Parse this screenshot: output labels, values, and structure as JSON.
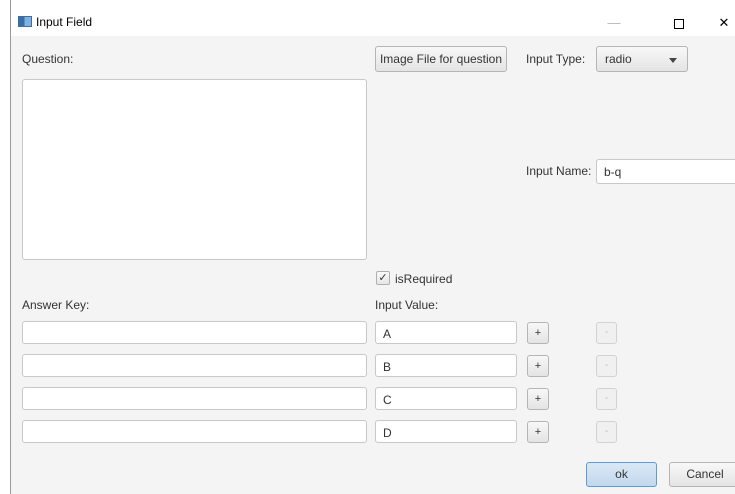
{
  "window": {
    "title": "Input Field",
    "minimize_glyph": "—",
    "close_glyph": "✕"
  },
  "question": {
    "label": "Question:",
    "value": "",
    "image_button": "Image File for question"
  },
  "input_type": {
    "label": "Input Type:",
    "selected": "radio"
  },
  "input_name": {
    "label": "Input Name:",
    "value": "b-q"
  },
  "required": {
    "label": "isRequired",
    "checked": true,
    "check_glyph": "✓"
  },
  "answer_key": {
    "label": "Answer Key:",
    "rows": [
      {
        "value": ""
      },
      {
        "value": ""
      },
      {
        "value": ""
      },
      {
        "value": ""
      }
    ]
  },
  "input_value": {
    "label": "Input Value:",
    "rows": [
      {
        "value": "A"
      },
      {
        "value": "B"
      },
      {
        "value": "C"
      },
      {
        "value": "D"
      }
    ]
  },
  "row_buttons": {
    "add": "+",
    "remove": "-"
  },
  "footer": {
    "ok": "ok",
    "cancel": "Cancel"
  },
  "colors": {
    "window_bg": "#f4f4f4",
    "ok_border": "#5e9ad4"
  }
}
